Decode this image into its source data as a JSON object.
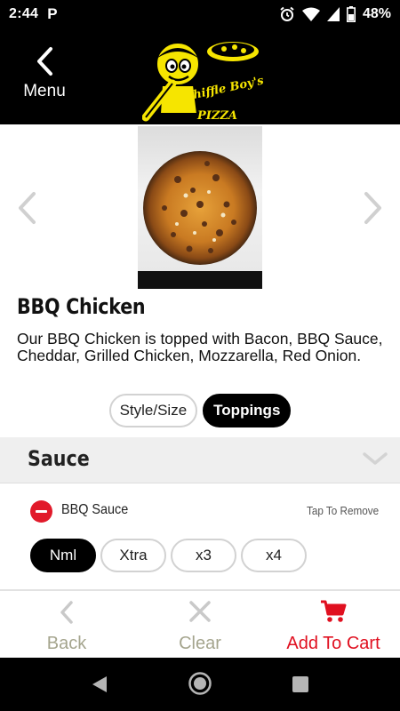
{
  "status_bar": {
    "time": "2:44",
    "app_icon": "P",
    "battery": "48%",
    "icons": [
      "alarm-icon",
      "wifi-icon",
      "cell-signal-icon",
      "battery-icon"
    ]
  },
  "header": {
    "back_label": "Menu",
    "logo_text": "Whiffle Boy's",
    "logo_subtext": "PIZZA"
  },
  "item": {
    "title": "BBQ Chicken",
    "description": "Our BBQ Chicken is topped with Bacon, BBQ Sauce, Cheddar, Grilled Chicken, Mozzarella, Red Onion."
  },
  "tabs": [
    {
      "label": "Style/Size",
      "active": false
    },
    {
      "label": "Toppings",
      "active": true
    }
  ],
  "sauce_section": {
    "title": "Sauce",
    "selected": {
      "name": "BBQ Sauce",
      "remove_hint": "Tap To Remove"
    },
    "amounts": [
      {
        "label": "Nml",
        "active": true
      },
      {
        "label": "Xtra",
        "active": false
      },
      {
        "label": "x3",
        "active": false
      },
      {
        "label": "x4",
        "active": false
      }
    ]
  },
  "actions": {
    "back": "Back",
    "clear": "Clear",
    "add_to_cart": "Add To Cart"
  },
  "colors": {
    "accent_red": "#e01020",
    "remove_red": "#e11a2a",
    "logo_yellow": "#f6e500",
    "disabled_label": "#a5a58e"
  }
}
